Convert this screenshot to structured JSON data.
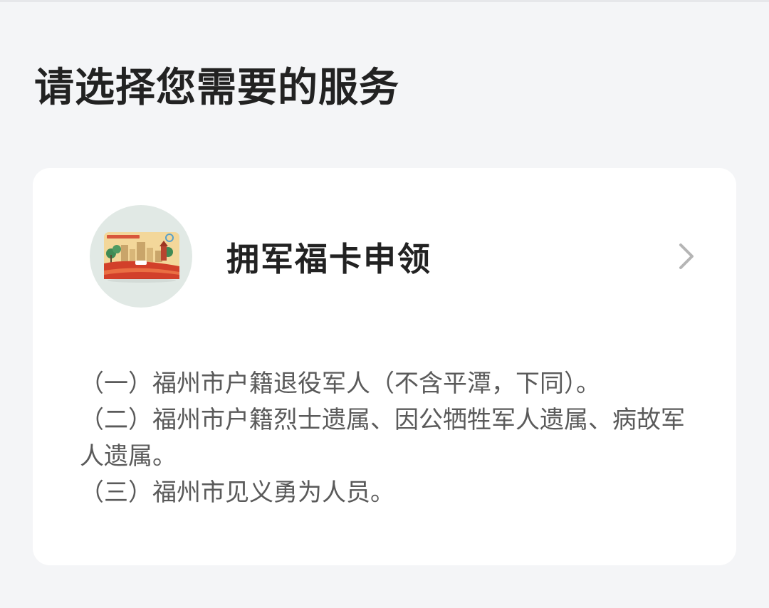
{
  "page": {
    "title": "请选择您需要的服务"
  },
  "service": {
    "name": "拥军福卡申领",
    "card_image_icon": "military-welfare-card-icon",
    "chevron_icon": "chevron-right-icon",
    "eligibility": [
      "（一）福州市户籍退役军人（不含平潭，下同）。",
      "（二）福州市户籍烈士遗属、因公牺牲军人遗属、病故军人遗属。",
      "（三）福州市见义勇为人员。"
    ]
  },
  "colors": {
    "background": "#f4f5f7",
    "card": "#ffffff",
    "title_text": "#222222",
    "description_text": "#5a5a5a",
    "chevron": "#b5b5b5",
    "avatar_bg": "#e1e9e5",
    "card_accent_red": "#d2402a"
  }
}
